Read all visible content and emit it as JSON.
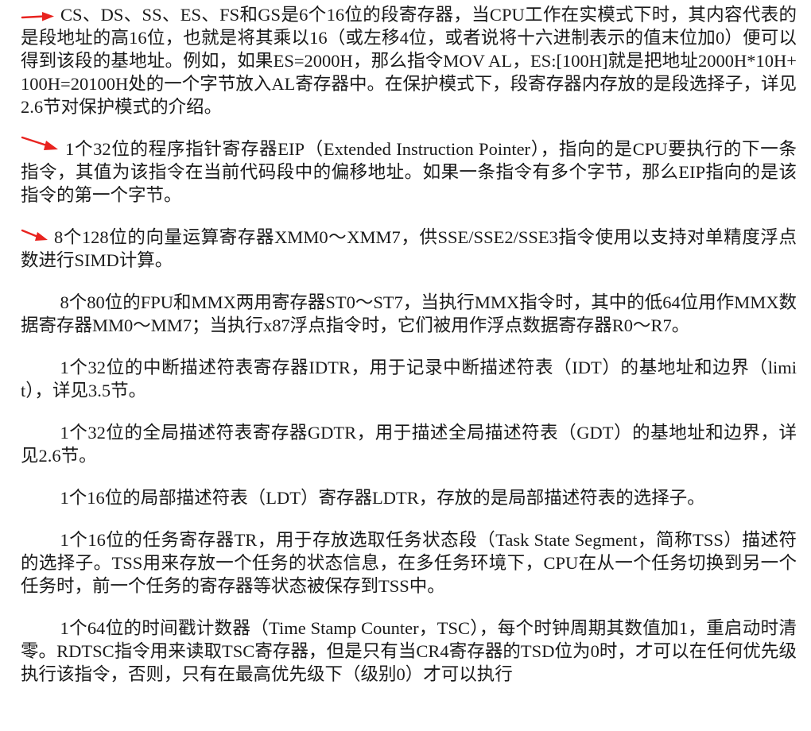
{
  "paragraphs": [
    {
      "arrow": "red-arrow-icon",
      "text": "CS、DS、SS、ES、FS和GS是6个16位的段寄存器，当CPU工作在实模式下时，其内容代表的是段地址的高16位，也就是将其乘以16（或左移4位，或者说将十六进制表示的值末位加0）便可以得到该段的基地址。例如，如果ES=2000H，那么指令MOV AL，ES:[100H]就是把地址2000H*10H+100H=20100H处的一个字节放入AL寄存器中。在保护模式下，段寄存器内存放的是段选择子，详见2.6节对保护模式的介绍。"
    },
    {
      "arrow": "red-arrow-icon",
      "text": "1个32位的程序指针寄存器EIP（Extended Instruction Pointer），指向的是CPU要执行的下一条指令，其值为该指令在当前代码段中的偏移地址。如果一条指令有多个字节，那么EIP指向的是该指令的第一个字节。"
    },
    {
      "arrow": "red-arrow-icon",
      "text": "8个128位的向量运算寄存器XMM0～XMM7，供SSE/SSE2/SSE3指令使用以支持对单精度浮点数进行SIMD计算。"
    },
    {
      "text": "8个80位的FPU和MMX两用寄存器ST0～ST7，当执行MMX指令时，其中的低64位用作MMX数据寄存器MM0～MM7；当执行x87浮点指令时，它们被用作浮点数据寄存器R0～R7。"
    },
    {
      "text": "1个32位的中断描述符表寄存器IDTR，用于记录中断描述符表（IDT）的基地址和边界（limit），详见3.5节。"
    },
    {
      "text": "1个32位的全局描述符表寄存器GDTR，用于描述全局描述符表（GDT）的基地址和边界，详见2.6节。"
    },
    {
      "text": "1个16位的局部描述符表（LDT）寄存器LDTR，存放的是局部描述符表的选择子。"
    },
    {
      "text": "1个16位的任务寄存器TR，用于存放选取任务状态段（Task State Segment，简称TSS）描述符的选择子。TSS用来存放一个任务的状态信息，在多任务环境下，CPU在从一个任务切换到另一个任务时，前一个任务的寄存器等状态被保存到TSS中。"
    },
    {
      "text": "1个64位的时间戳计数器（Time Stamp Counter，TSC），每个时钟周期其数值加1，重启动时清零。RDTSC指令用来读取TSC寄存器，但是只有当CR4寄存器的TSD位为0时，才可以在任何优先级执行该指令，否则，只有在最高优先级下（级别0）才可以执行"
    }
  ],
  "colors": {
    "arrow": "#e8231f",
    "text": "#1a1a1a",
    "background": "#ffffff"
  }
}
